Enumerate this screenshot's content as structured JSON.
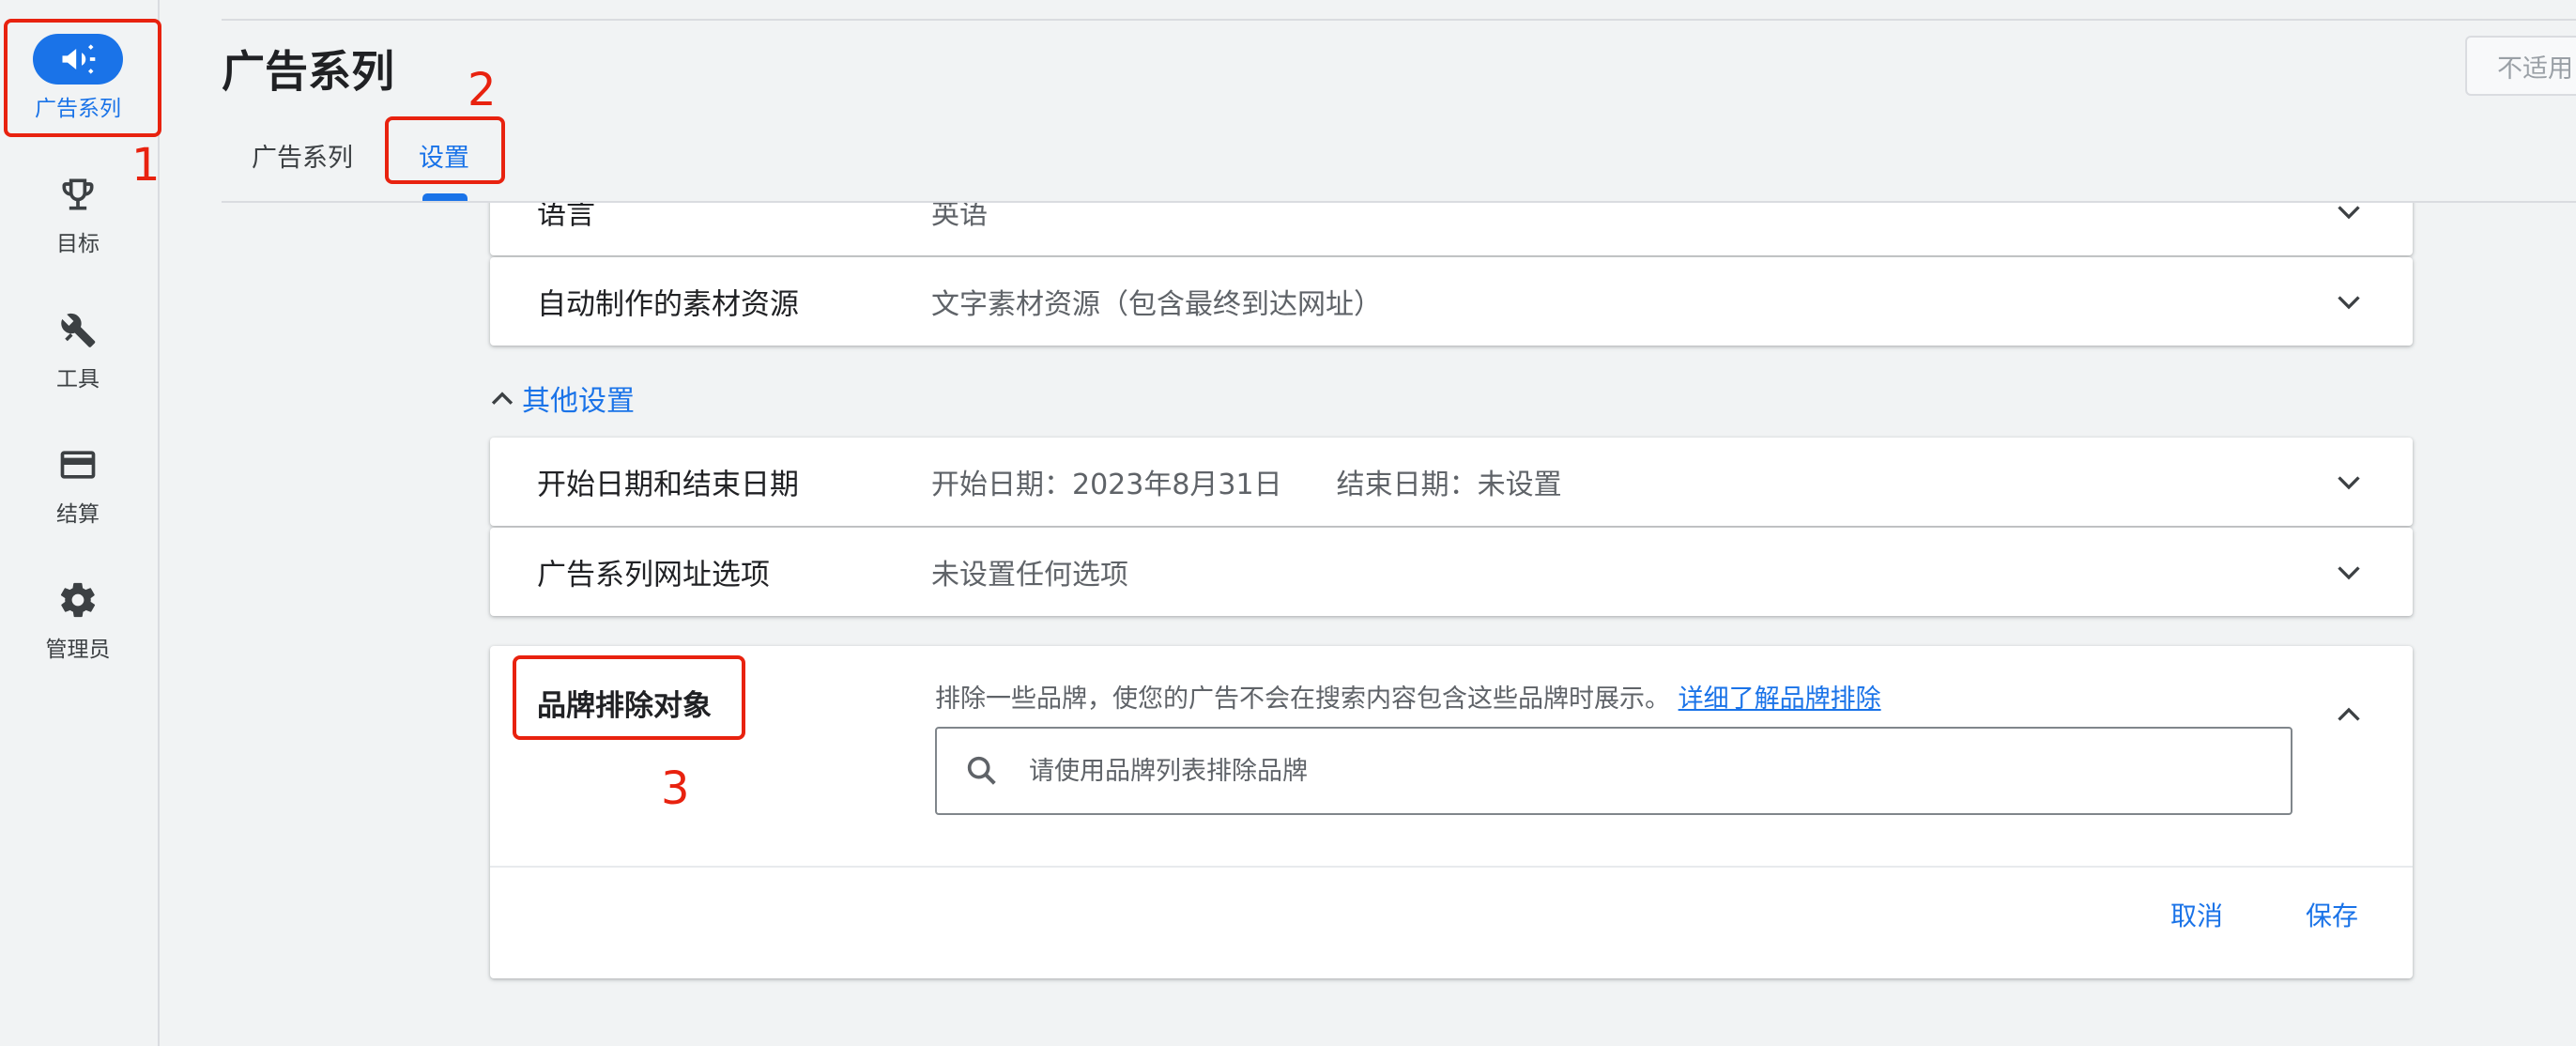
{
  "nav": {
    "items": [
      {
        "label": "广告系列",
        "icon": "megaphone-icon",
        "active": true
      },
      {
        "label": "目标",
        "icon": "trophy-icon",
        "active": false
      },
      {
        "label": "工具",
        "icon": "tools-icon",
        "active": false
      },
      {
        "label": "结算",
        "icon": "credit-card-icon",
        "active": false
      },
      {
        "label": "管理员",
        "icon": "gear-icon",
        "active": false
      }
    ]
  },
  "header": {
    "title": "广告系列",
    "status_button": "不适用",
    "tabs": [
      {
        "label": "广告系列",
        "active": false
      },
      {
        "label": "设置",
        "active": true
      }
    ]
  },
  "settings": {
    "rows": [
      {
        "label": "语言",
        "value": "英语"
      },
      {
        "label": "自动制作的素材资源",
        "value": "文字素材资源（包含最终到达网址）"
      }
    ],
    "other_section_label": "其他设置",
    "other_rows": [
      {
        "label": "开始日期和结束日期",
        "start_label": "开始日期：",
        "start_value": "2023年8月31日",
        "end_label": "结束日期：",
        "end_value": "未设置"
      },
      {
        "label": "广告系列网址选项",
        "value": "未设置任何选项"
      }
    ],
    "brand_exclusion": {
      "label": "品牌排除对象",
      "description": "排除一些品牌，使您的广告不会在搜索内容包含这些品牌时展示。",
      "learn_more": "详细了解品牌排除",
      "search_placeholder": "请使用品牌列表排除品牌",
      "cancel": "取消",
      "save": "保存"
    }
  },
  "annotations": [
    "1",
    "2",
    "3"
  ],
  "colors": {
    "accent": "#1a73e8",
    "annotation": "#e8220f",
    "background": "#f1f3f4"
  }
}
